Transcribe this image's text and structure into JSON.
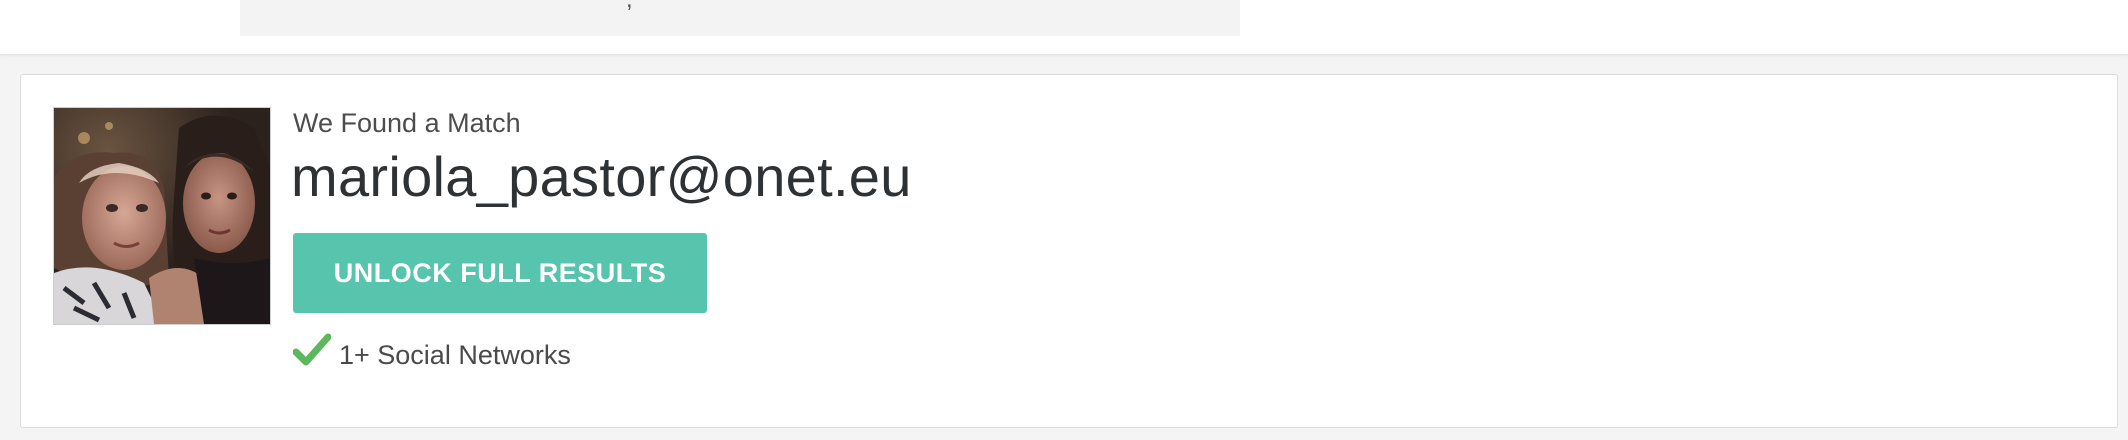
{
  "match": {
    "heading": "We Found a Match",
    "email": "mariola_pastor@onet.eu",
    "unlock_label": "UNLOCK FULL RESULTS",
    "features": [
      {
        "icon": "checkmark-icon",
        "label": "1+ Social Networks"
      }
    ]
  },
  "colors": {
    "accent": "#57c4ae",
    "check": "#5cb85c",
    "email_text": "#2f3235",
    "page_background": "#f4f4f4"
  }
}
